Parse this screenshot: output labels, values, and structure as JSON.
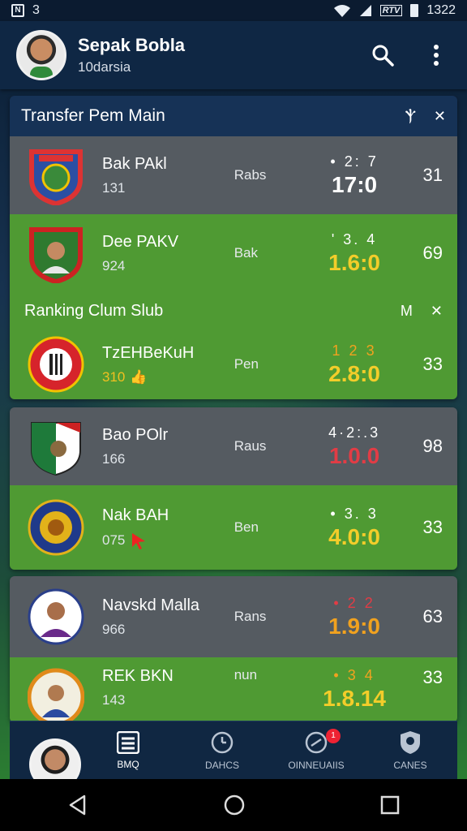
{
  "status_bar": {
    "left_glyph": "3",
    "carrier_badge": "RTV",
    "time": "1322"
  },
  "header": {
    "title": "Sepak Bobla",
    "subtitle": "10darsia"
  },
  "section1": {
    "title": "Transfer Pem Main",
    "tool1": "Ⲯ",
    "tool2": "✕"
  },
  "section2": {
    "title": "Ranking  Clum Slub",
    "tool1": "M",
    "tool2": "✕"
  },
  "rows": [
    {
      "name": "Bak PAkl",
      "num": "131",
      "type": "Rabs",
      "top": "• 2: 7",
      "score": "17:0",
      "right": "31",
      "color": "#ffffff",
      "bg": "gray"
    },
    {
      "name": "Dee PAKV",
      "num": "924",
      "type": "Bak",
      "top": "' 3. 4",
      "score": "1.6:0",
      "right": "69",
      "color": "#f3cd2a",
      "bg": "green"
    },
    {
      "name": "TzEHBeKuH",
      "num": "310",
      "type": "Pen",
      "top": "1  2  3",
      "score": "2.8:0",
      "right": "33",
      "color": "#f3cd2a",
      "bg": "green"
    },
    {
      "name": "Bao POlr",
      "num": "166",
      "type": "Raus",
      "top": "4·2:.3",
      "score": "1.0.0",
      "right": "98",
      "color": "#e23c45",
      "bg": "gray"
    },
    {
      "name": "Nak BAH",
      "num": "075",
      "type": "Ben",
      "top": "• 3. 3",
      "score": "4.0:0",
      "right": "33",
      "color": "#f3cd2a",
      "bg": "green"
    },
    {
      "name": "Navskd Malla",
      "num": "966",
      "type": "Rans",
      "top": "• 2  2",
      "score": "1.9:0",
      "right": "63",
      "color": "#f1a21f",
      "bg": "gray"
    },
    {
      "name": "REK BKN",
      "num": "143",
      "type": "nun",
      "top": "• 3  4",
      "score": "1.8.14",
      "right": "33",
      "color": "#f3cd2a",
      "bg": "green"
    }
  ],
  "bottom_nav": {
    "items": [
      {
        "label": "BMQ",
        "icon": "list-icon"
      },
      {
        "label": "DAHCS",
        "icon": "clock-icon"
      },
      {
        "label": "OINNEUAIIS",
        "icon": "whistle-icon"
      },
      {
        "label": "CANES",
        "icon": "shield-icon"
      }
    ],
    "badge": "1"
  }
}
